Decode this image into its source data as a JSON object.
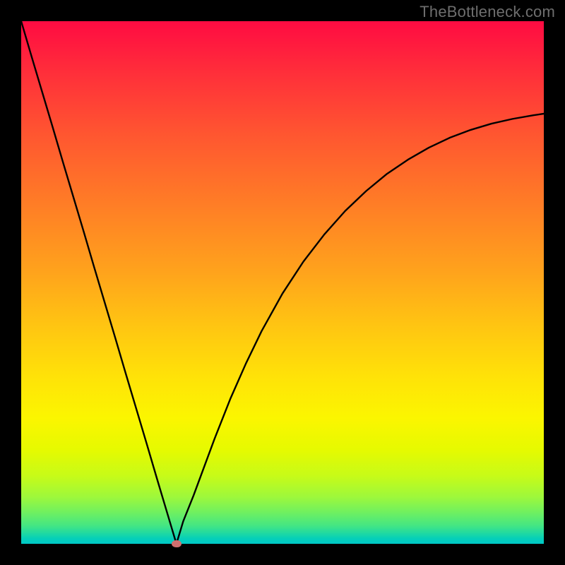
{
  "chart_data": {
    "type": "line",
    "title": "",
    "xlabel": "",
    "ylabel": "",
    "xlim": [
      0,
      1
    ],
    "ylim": [
      0,
      1
    ],
    "x": [
      0.0,
      0.02,
      0.04,
      0.06,
      0.08,
      0.1,
      0.12,
      0.14,
      0.16,
      0.18,
      0.2,
      0.22,
      0.24,
      0.26,
      0.28,
      0.297,
      0.31,
      0.33,
      0.35,
      0.37,
      0.4,
      0.43,
      0.46,
      0.5,
      0.54,
      0.58,
      0.62,
      0.66,
      0.7,
      0.74,
      0.78,
      0.82,
      0.86,
      0.9,
      0.94,
      0.98,
      1.0
    ],
    "values": [
      1.0,
      0.932,
      0.865,
      0.798,
      0.73,
      0.663,
      0.596,
      0.528,
      0.461,
      0.394,
      0.326,
      0.259,
      0.192,
      0.124,
      0.057,
      0.0,
      0.043,
      0.093,
      0.147,
      0.201,
      0.277,
      0.345,
      0.407,
      0.479,
      0.54,
      0.592,
      0.637,
      0.675,
      0.708,
      0.735,
      0.758,
      0.777,
      0.792,
      0.804,
      0.813,
      0.82,
      0.823
    ],
    "grid": false,
    "legend": false,
    "curve_vertex_x": 0.297,
    "marker": {
      "x": 0.297,
      "y": 0.0
    }
  },
  "watermark": {
    "text": "TheBottleneck.com"
  },
  "background_gradient_colors": [
    "#ff0b42",
    "#ff7d26",
    "#ffe208",
    "#9ef83b",
    "#00c7c7"
  ]
}
